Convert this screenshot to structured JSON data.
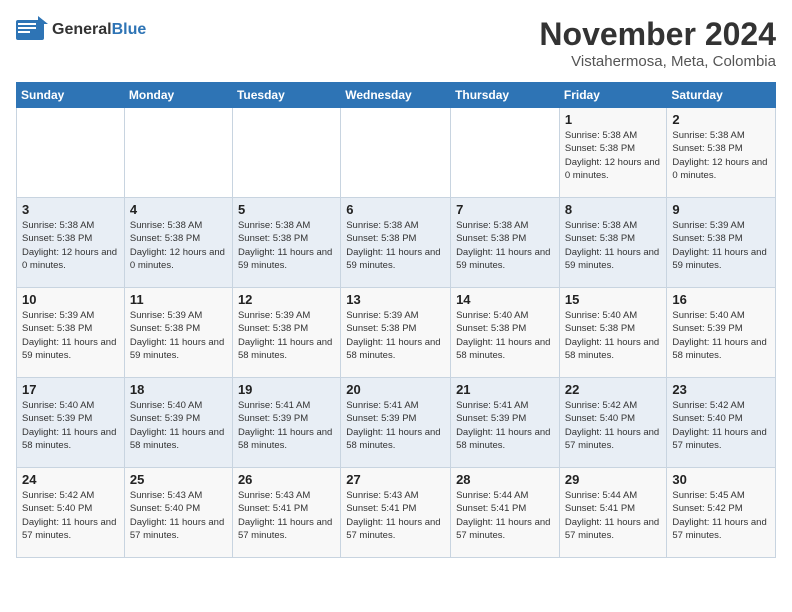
{
  "header": {
    "logo_general": "General",
    "logo_blue": "Blue",
    "month_year": "November 2024",
    "location": "Vistahermosa, Meta, Colombia"
  },
  "days_of_week": [
    "Sunday",
    "Monday",
    "Tuesday",
    "Wednesday",
    "Thursday",
    "Friday",
    "Saturday"
  ],
  "weeks": [
    [
      {
        "day": "",
        "detail": ""
      },
      {
        "day": "",
        "detail": ""
      },
      {
        "day": "",
        "detail": ""
      },
      {
        "day": "",
        "detail": ""
      },
      {
        "day": "",
        "detail": ""
      },
      {
        "day": "1",
        "detail": "Sunrise: 5:38 AM\nSunset: 5:38 PM\nDaylight: 12 hours and 0 minutes."
      },
      {
        "day": "2",
        "detail": "Sunrise: 5:38 AM\nSunset: 5:38 PM\nDaylight: 12 hours and 0 minutes."
      }
    ],
    [
      {
        "day": "3",
        "detail": "Sunrise: 5:38 AM\nSunset: 5:38 PM\nDaylight: 12 hours and 0 minutes."
      },
      {
        "day": "4",
        "detail": "Sunrise: 5:38 AM\nSunset: 5:38 PM\nDaylight: 12 hours and 0 minutes."
      },
      {
        "day": "5",
        "detail": "Sunrise: 5:38 AM\nSunset: 5:38 PM\nDaylight: 11 hours and 59 minutes."
      },
      {
        "day": "6",
        "detail": "Sunrise: 5:38 AM\nSunset: 5:38 PM\nDaylight: 11 hours and 59 minutes."
      },
      {
        "day": "7",
        "detail": "Sunrise: 5:38 AM\nSunset: 5:38 PM\nDaylight: 11 hours and 59 minutes."
      },
      {
        "day": "8",
        "detail": "Sunrise: 5:38 AM\nSunset: 5:38 PM\nDaylight: 11 hours and 59 minutes."
      },
      {
        "day": "9",
        "detail": "Sunrise: 5:39 AM\nSunset: 5:38 PM\nDaylight: 11 hours and 59 minutes."
      }
    ],
    [
      {
        "day": "10",
        "detail": "Sunrise: 5:39 AM\nSunset: 5:38 PM\nDaylight: 11 hours and 59 minutes."
      },
      {
        "day": "11",
        "detail": "Sunrise: 5:39 AM\nSunset: 5:38 PM\nDaylight: 11 hours and 59 minutes."
      },
      {
        "day": "12",
        "detail": "Sunrise: 5:39 AM\nSunset: 5:38 PM\nDaylight: 11 hours and 58 minutes."
      },
      {
        "day": "13",
        "detail": "Sunrise: 5:39 AM\nSunset: 5:38 PM\nDaylight: 11 hours and 58 minutes."
      },
      {
        "day": "14",
        "detail": "Sunrise: 5:40 AM\nSunset: 5:38 PM\nDaylight: 11 hours and 58 minutes."
      },
      {
        "day": "15",
        "detail": "Sunrise: 5:40 AM\nSunset: 5:38 PM\nDaylight: 11 hours and 58 minutes."
      },
      {
        "day": "16",
        "detail": "Sunrise: 5:40 AM\nSunset: 5:39 PM\nDaylight: 11 hours and 58 minutes."
      }
    ],
    [
      {
        "day": "17",
        "detail": "Sunrise: 5:40 AM\nSunset: 5:39 PM\nDaylight: 11 hours and 58 minutes."
      },
      {
        "day": "18",
        "detail": "Sunrise: 5:40 AM\nSunset: 5:39 PM\nDaylight: 11 hours and 58 minutes."
      },
      {
        "day": "19",
        "detail": "Sunrise: 5:41 AM\nSunset: 5:39 PM\nDaylight: 11 hours and 58 minutes."
      },
      {
        "day": "20",
        "detail": "Sunrise: 5:41 AM\nSunset: 5:39 PM\nDaylight: 11 hours and 58 minutes."
      },
      {
        "day": "21",
        "detail": "Sunrise: 5:41 AM\nSunset: 5:39 PM\nDaylight: 11 hours and 58 minutes."
      },
      {
        "day": "22",
        "detail": "Sunrise: 5:42 AM\nSunset: 5:40 PM\nDaylight: 11 hours and 57 minutes."
      },
      {
        "day": "23",
        "detail": "Sunrise: 5:42 AM\nSunset: 5:40 PM\nDaylight: 11 hours and 57 minutes."
      }
    ],
    [
      {
        "day": "24",
        "detail": "Sunrise: 5:42 AM\nSunset: 5:40 PM\nDaylight: 11 hours and 57 minutes."
      },
      {
        "day": "25",
        "detail": "Sunrise: 5:43 AM\nSunset: 5:40 PM\nDaylight: 11 hours and 57 minutes."
      },
      {
        "day": "26",
        "detail": "Sunrise: 5:43 AM\nSunset: 5:41 PM\nDaylight: 11 hours and 57 minutes."
      },
      {
        "day": "27",
        "detail": "Sunrise: 5:43 AM\nSunset: 5:41 PM\nDaylight: 11 hours and 57 minutes."
      },
      {
        "day": "28",
        "detail": "Sunrise: 5:44 AM\nSunset: 5:41 PM\nDaylight: 11 hours and 57 minutes."
      },
      {
        "day": "29",
        "detail": "Sunrise: 5:44 AM\nSunset: 5:41 PM\nDaylight: 11 hours and 57 minutes."
      },
      {
        "day": "30",
        "detail": "Sunrise: 5:45 AM\nSunset: 5:42 PM\nDaylight: 11 hours and 57 minutes."
      }
    ]
  ]
}
